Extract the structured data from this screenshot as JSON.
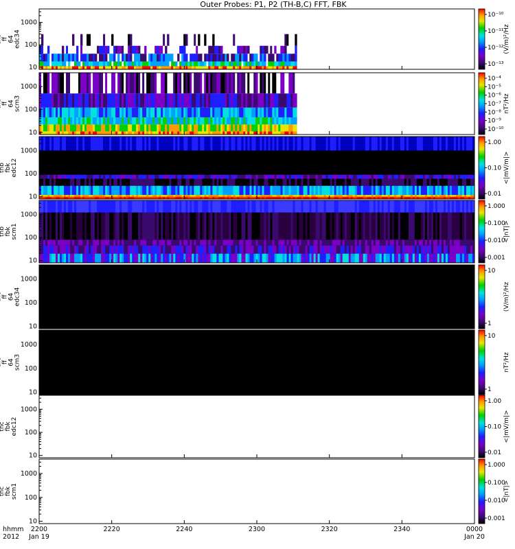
{
  "title": "Outer Probes: P1, P2 (TH-B,C) FFT, FBK",
  "x_axis": {
    "row_label_top": "hhmm",
    "row_label_bottom": "2012",
    "ticks": [
      "2200",
      "2220",
      "2240",
      "2300",
      "2320",
      "2340",
      "0000"
    ],
    "date_labels": [
      "Jan 19",
      "Jan 20"
    ]
  },
  "panels": [
    {
      "label_lines": [
        "thb",
        "ff",
        "64",
        "edc34"
      ],
      "yticks": [
        "10",
        "100",
        "1000"
      ],
      "cb_unit": "(V/m)²/Hz",
      "cb_ticks": [
        "10⁻¹⁰",
        "10⁻¹¹",
        "10⁻¹²",
        "10⁻¹³"
      ],
      "has_data": true
    },
    {
      "label_lines": [
        "thb",
        "ff",
        "64",
        "scm3"
      ],
      "yticks": [
        "10",
        "100",
        "1000"
      ],
      "cb_unit": "nT²/Hz",
      "cb_ticks": [
        "10⁻⁴",
        "10⁻⁵",
        "10⁻⁶",
        "10⁻⁷",
        "10⁻⁸",
        "10⁻⁹",
        "10⁻¹⁰"
      ],
      "has_data": true
    },
    {
      "label_lines": [
        "thb",
        "fbk",
        "edc12"
      ],
      "yticks": [
        "10",
        "100",
        "1000"
      ],
      "cb_unit": "<|mV/m|>",
      "cb_ticks": [
        "1.00",
        "0.10",
        "0.01"
      ],
      "has_data": true
    },
    {
      "label_lines": [
        "thb",
        "fbk",
        "scm1"
      ],
      "yticks": [
        "10",
        "100",
        "1000"
      ],
      "cb_unit": "<|nT|>",
      "cb_ticks": [
        "1.000",
        "0.100",
        "0.010",
        "0.001"
      ],
      "has_data": true
    },
    {
      "label_lines": [
        "thc",
        "ff",
        "64",
        "edc34"
      ],
      "yticks": [
        "10",
        "100",
        "1000"
      ],
      "cb_unit": "(V/m)²/Hz",
      "cb_ticks": [
        "10",
        "1"
      ],
      "has_data": true
    },
    {
      "label_lines": [
        "thc",
        "ff",
        "64",
        "scm3"
      ],
      "yticks": [
        "10",
        "100",
        "1000"
      ],
      "cb_unit": "nT²/Hz",
      "cb_ticks": [
        "10",
        "1"
      ],
      "has_data": true
    },
    {
      "label_lines": [
        "thc",
        "fbk",
        "edc12"
      ],
      "yticks": [
        "10",
        "100",
        "1000"
      ],
      "cb_unit": "<|mV/m|>",
      "cb_ticks": [
        "1.00",
        "0.10",
        "0.01"
      ],
      "has_data": false
    },
    {
      "label_lines": [
        "thc",
        "fbk",
        "scm1"
      ],
      "yticks": [
        "10",
        "100",
        "1000"
      ],
      "cb_unit": "<|nT|>",
      "cb_ticks": [
        "1.000",
        "0.100",
        "0.010",
        "0.001"
      ],
      "has_data": false
    }
  ],
  "chart_data": {
    "type": "heatmap",
    "title": "Outer Probes: P1, P2 (TH-B,C) FFT, FBK",
    "x_range": [
      "2012-01-19 22:00",
      "2012-01-20 00:00"
    ],
    "y_scale": "log",
    "ylim_hz": [
      8,
      4000
    ],
    "colormap": [
      "#000000",
      "#3b0a6e",
      "#7a00c8",
      "#1e1eff",
      "#00a0ff",
      "#00e0e0",
      "#00d000",
      "#e6e600",
      "#ff9900",
      "#ff0000"
    ],
    "series": [
      {
        "name": "thb ff 64 edc34",
        "data_end": "23:08",
        "colorbar_range": [
          "10⁻¹³",
          "10⁻¹⁰"
        ]
      },
      {
        "name": "thb ff 64 scm3",
        "data_end": "23:08",
        "colorbar_range": [
          "10⁻¹⁰",
          "10⁻⁴"
        ]
      },
      {
        "name": "thb fbk edc12",
        "data_end": "00:00",
        "colorbar_range": [
          "0.01",
          "1.00"
        ]
      },
      {
        "name": "thb fbk scm1",
        "data_end": "00:00",
        "colorbar_range": [
          "0.001",
          "1.000"
        ]
      },
      {
        "name": "thc ff 64 edc34",
        "data_end": "00:00",
        "colorbar_range": [
          "1",
          "10"
        ]
      },
      {
        "name": "thc ff 64 scm3",
        "data_end": "00:00",
        "colorbar_range": [
          "1",
          "10"
        ]
      },
      {
        "name": "thc fbk edc12",
        "data_end": null,
        "colorbar_range": [
          "0.01",
          "1.00"
        ]
      },
      {
        "name": "thc fbk scm1",
        "data_end": null,
        "colorbar_range": [
          "0.001",
          "1.000"
        ]
      }
    ]
  }
}
